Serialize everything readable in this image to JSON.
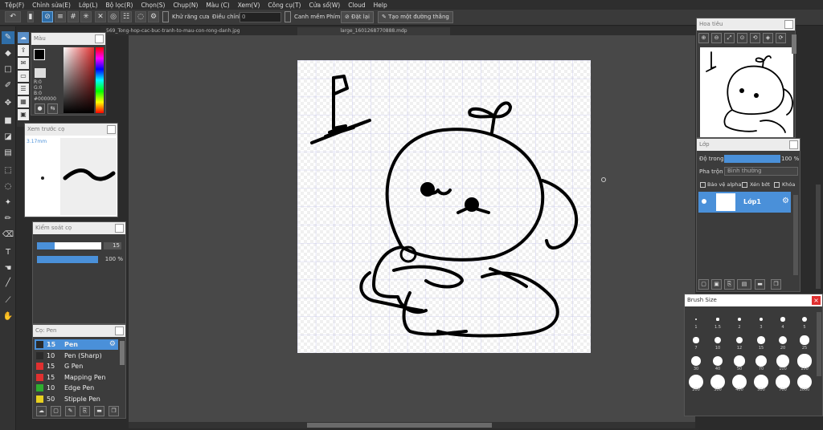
{
  "menu": [
    "Tệp(F)",
    "Chỉnh sửa(E)",
    "Lớp(L)",
    "Bộ lọc(R)",
    "Chọn(S)",
    "Chụp(N)",
    "Màu (C)",
    "Xem(V)",
    "Công cụ(T)",
    "Cửa sổ(W)",
    "Cloud",
    "Help"
  ],
  "toolbar": {
    "antialias_label": "Khử răng cưa",
    "adjust_label": "Điều chỉnh",
    "adjust_value": "0",
    "snap_label": "Canh mềm",
    "key_label": "Phím",
    "reset_label": "Đặt lại",
    "create_line_label": "Tạo một đường thẳng"
  },
  "tabs": [
    "_569_Tong-hop-cac-buc-tranh-to-mau-con-rong-danh.jpg",
    "large_1601268770888.mdp"
  ],
  "color_panel": {
    "title": "Màu",
    "r": "R:0",
    "g": "G:0",
    "b": "B:0",
    "hex": "#000000"
  },
  "brush_preview": {
    "title": "Xem trước cọ",
    "size": "3.17mm"
  },
  "brush_control": {
    "title": "Kiểm soát cọ",
    "size": "15",
    "opacity": "100 %"
  },
  "brush_panel": {
    "title": "Cọ: Pen",
    "items": [
      {
        "size": "15",
        "name": "Pen",
        "color": "#2a2a2a",
        "active": true
      },
      {
        "size": "10",
        "name": "Pen (Sharp)",
        "color": "#2a2a2a"
      },
      {
        "size": "15",
        "name": "G Pen",
        "color": "#e03030"
      },
      {
        "size": "15",
        "name": "Mapping Pen",
        "color": "#e03030"
      },
      {
        "size": "10",
        "name": "Edge Pen",
        "color": "#2fae2f"
      },
      {
        "size": "50",
        "name": "Stipple Pen",
        "color": "#e8d020"
      }
    ]
  },
  "navigator": {
    "title": "Hoa tiêu"
  },
  "layer_panel": {
    "title": "Lớp",
    "opacity_label": "Độ trong",
    "opacity_value": "100 %",
    "opacity_fraction": 1.0,
    "blend_label": "Pha trộn",
    "blend_value": "Bình thường",
    "protect_alpha": "Bảo vệ alpha",
    "clipping": "Xén bớt",
    "lock": "Khóa",
    "layer_name": "Lớp1"
  },
  "brush_size": {
    "title": "Brush Size",
    "sizes": [
      "1",
      "1.5",
      "2",
      "3",
      "4",
      "5",
      "7",
      "10",
      "12",
      "15",
      "20",
      "25",
      "30",
      "40",
      "50",
      "70",
      "100",
      "150",
      "200",
      "300",
      "400",
      "500",
      "700",
      "1000"
    ]
  },
  "colors": {
    "accent": "#2f6ea8",
    "panel_title": "#ececec",
    "selected": "#4a90d9"
  }
}
